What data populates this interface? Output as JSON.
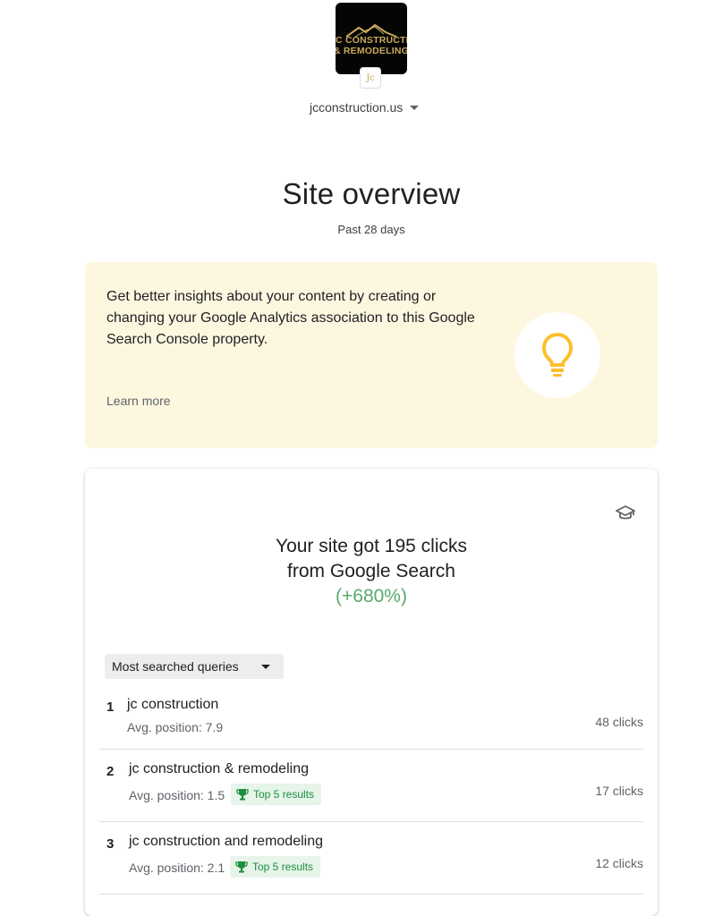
{
  "property": {
    "logo_lines": [
      "JC CONSTRUCTION",
      "& REMODELING"
    ],
    "favicon_text": "Jc",
    "site_name": "jcconstruction.us"
  },
  "overview": {
    "title": "Site overview",
    "period": "Past 28 days"
  },
  "insight": {
    "text": "Get better insights about your content by creating or changing your Google Analytics association to this Google Search Console property.",
    "learn_more": "Learn more",
    "icon": "lightbulb-icon"
  },
  "performance": {
    "headline_line1": "Your site got 195 clicks",
    "headline_line2": "from Google Search",
    "change": "(+680%)",
    "selector_label": "Most searched queries",
    "queries": [
      {
        "rank": "1",
        "query": "jc construction",
        "avg_position": "Avg. position: 7.9",
        "badge": "",
        "clicks": "48 clicks"
      },
      {
        "rank": "2",
        "query": "jc construction & remodeling",
        "avg_position": "Avg. position: 1.5",
        "badge": "Top 5 results",
        "clicks": "17 clicks"
      },
      {
        "rank": "3",
        "query": "jc construction and remodeling",
        "avg_position": "Avg. position: 2.1",
        "badge": "Top 5 results",
        "clicks": "12 clicks"
      }
    ]
  },
  "colors": {
    "insight_bg": "#fef7e0",
    "bulb": "#fbc02d",
    "positive": "#1e8e3e",
    "logo_gold": "#c9a85a"
  }
}
